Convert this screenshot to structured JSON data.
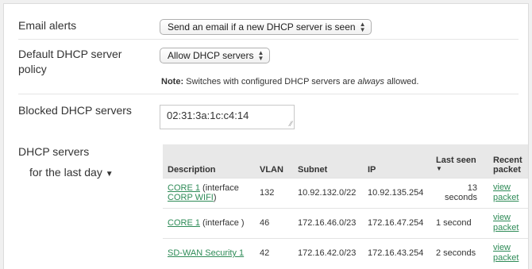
{
  "email_alerts": {
    "label": "Email alerts",
    "select_value": "Send an email if a new DHCP server is seen"
  },
  "default_policy": {
    "label": "Default DHCP server policy",
    "select_value": "Allow DHCP servers",
    "note_bold": "Note:",
    "note_text": " Switches with configured DHCP servers are ",
    "note_em": "always",
    "note_end": " allowed."
  },
  "blocked": {
    "label": "Blocked DHCP servers",
    "value": "02:31:3a:1c:c4:14"
  },
  "dhcp_servers": {
    "label": "DHCP servers",
    "range_label": "for the last day",
    "columns": [
      "Description",
      "VLAN",
      "Subnet",
      "IP",
      "Last seen",
      "Recent packet"
    ],
    "rows": [
      {
        "desc_link": "CORE 1",
        "desc_rest": " (interface",
        "desc_link2": "CORP WIFI",
        "desc_end": ")",
        "vlan": "132",
        "subnet": "10.92.132.0/22",
        "ip": "10.92.135.254",
        "last_seen": "13 seconds",
        "packet_1": "view",
        "packet_2": "packet"
      },
      {
        "desc_link": "CORE 1",
        "desc_rest": " (interface )",
        "vlan": "46",
        "subnet": "172.16.46.0/23",
        "ip": "172.16.47.254",
        "last_seen": "1 second",
        "packet_1": "view",
        "packet_2": "packet"
      },
      {
        "desc_link": "SD-WAN Security 1",
        "vlan": "42",
        "subnet": "172.16.42.0/23",
        "ip": "172.16.43.254",
        "last_seen": "2 seconds",
        "packet_1": "view",
        "packet_2": "packet"
      }
    ]
  },
  "colors": {
    "link": "#2e8b57",
    "header_bg": "#e8e8e8"
  }
}
